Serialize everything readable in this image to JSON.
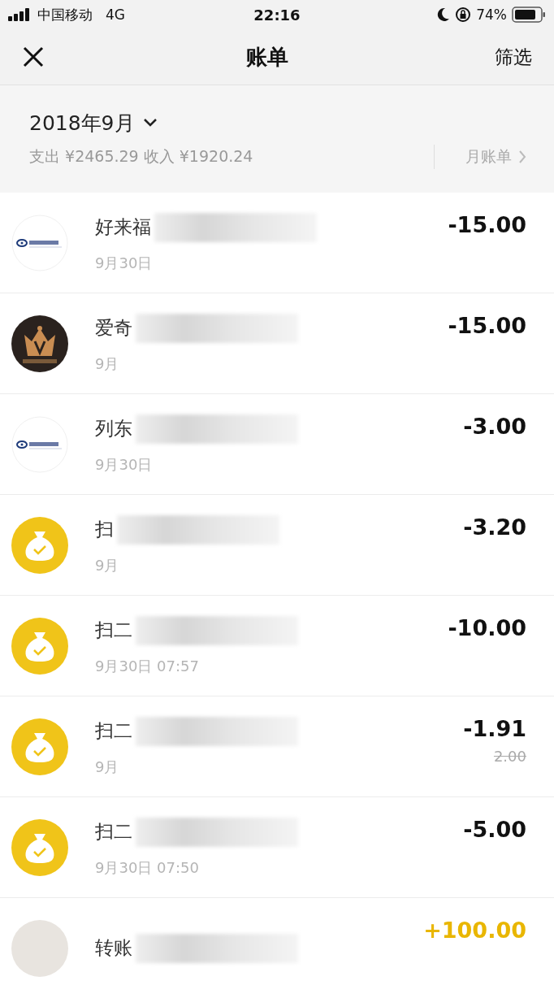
{
  "status_bar": {
    "carrier": "中国移动",
    "network": "4G",
    "time": "22:16",
    "battery_percent": "74%"
  },
  "nav": {
    "title": "账单",
    "action": "筛选"
  },
  "summary": {
    "month": "2018年9月",
    "totals": "支出 ¥2465.29 收入 ¥1920.24",
    "monthly_bill": "月账单"
  },
  "transactions": [
    {
      "kind": "bank",
      "title": "好来福",
      "redacted": true,
      "date": "9月30日",
      "amount": "-15.00",
      "income": false
    },
    {
      "kind": "crown",
      "title": "爱奇",
      "redacted": true,
      "date": "9月",
      "amount": "-15.00",
      "income": false
    },
    {
      "kind": "bank",
      "title": "列东",
      "redacted": true,
      "date": "9月30日",
      "amount": "-3.00",
      "income": false
    },
    {
      "kind": "moneybag",
      "title": "扫",
      "redacted": true,
      "date": "9月",
      "amount": "-3.20",
      "income": false
    },
    {
      "kind": "moneybag",
      "title": "扫二",
      "redacted": true,
      "date": "9月30日 07:57",
      "amount": "-10.00",
      "income": false
    },
    {
      "kind": "moneybag",
      "title": "扫二",
      "redacted": true,
      "date": "9月",
      "amount": "-1.91",
      "original_amount": "2.00",
      "income": false
    },
    {
      "kind": "moneybag",
      "title": "扫二",
      "redacted": true,
      "date": "9月30日 07:50",
      "amount": "-5.00",
      "income": false
    },
    {
      "kind": "photo",
      "title": "转账",
      "redacted": true,
      "amount": "+100.00",
      "income": true
    }
  ]
}
